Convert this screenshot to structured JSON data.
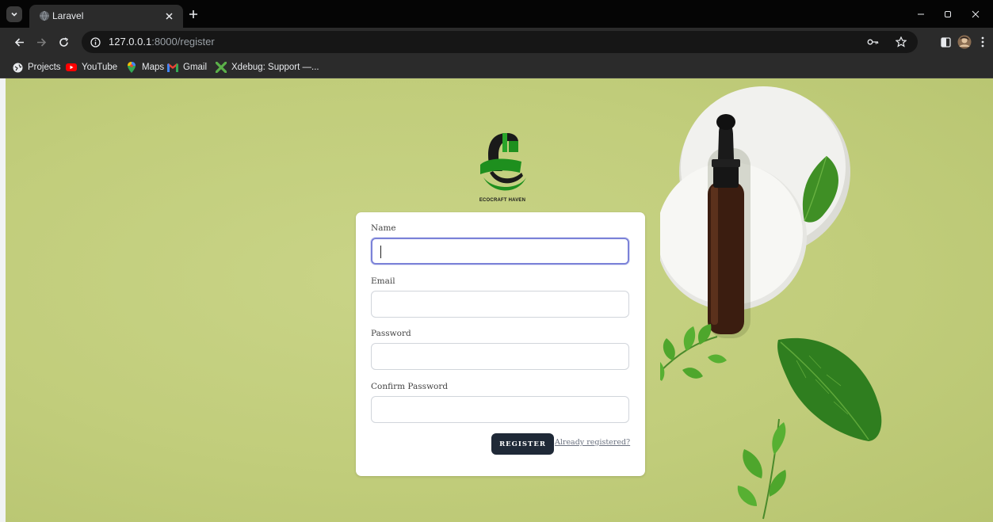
{
  "browser": {
    "tab_title": "Laravel",
    "url_host": "127.0.0.1",
    "url_path": ":8000/register",
    "bookmarks": [
      {
        "label": "Projects",
        "icon": "globe-icon"
      },
      {
        "label": "YouTube",
        "icon": "youtube-icon"
      },
      {
        "label": "Maps",
        "icon": "maps-icon"
      },
      {
        "label": "Gmail",
        "icon": "gmail-icon"
      },
      {
        "label": "Xdebug: Support —...",
        "icon": "xdebug-icon"
      }
    ]
  },
  "page": {
    "logo_text": "ECOCRAFT HAVEN",
    "form": {
      "name_label": "Name",
      "name_value": "",
      "email_label": "Email",
      "email_value": "",
      "password_label": "Password",
      "password_value": "",
      "confirm_password_label": "Confirm Password",
      "confirm_password_value": "",
      "register_label": "REGISTER",
      "login_link_label": "Already registered?"
    }
  },
  "colors": {
    "background": "#c3cf7e",
    "button": "#1f2937",
    "focus_ring": "#7b82d8",
    "logo_green": "#1e8f1e"
  }
}
